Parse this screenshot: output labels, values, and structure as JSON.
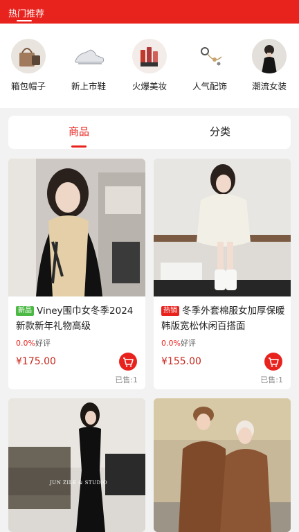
{
  "header": {
    "title": "热门推荐"
  },
  "categories": [
    {
      "label": "箱包帽子",
      "icon": "bag-icon"
    },
    {
      "label": "新上市鞋",
      "icon": "sneaker-icon"
    },
    {
      "label": "火爆美妆",
      "icon": "lipstick-icon"
    },
    {
      "label": "人气配饰",
      "icon": "jewelry-icon"
    },
    {
      "label": "潮流女装",
      "icon": "dress-icon"
    }
  ],
  "tabs": [
    {
      "label": "商品",
      "active": true
    },
    {
      "label": "分类",
      "active": false
    }
  ],
  "products": [
    {
      "badge": "新品",
      "title": "Viney围巾女冬季2024新款新年礼物高级",
      "rating_pct": "0.0%",
      "rating_label": "好评",
      "price": "¥175.00",
      "sold": "已售:1"
    },
    {
      "badge": "热销",
      "title": "冬季外套棉服女加厚保暖韩版宽松休闲百搭面",
      "rating_pct": "0.0%",
      "rating_label": "好评",
      "price": "¥155.00",
      "sold": "已售:1"
    },
    {
      "photo_text": "JUN ZILE & STUDIO"
    },
    {}
  ],
  "colors": {
    "accent": "#e8231e",
    "price": "#c8281e",
    "new_badge": "#4cb944"
  }
}
